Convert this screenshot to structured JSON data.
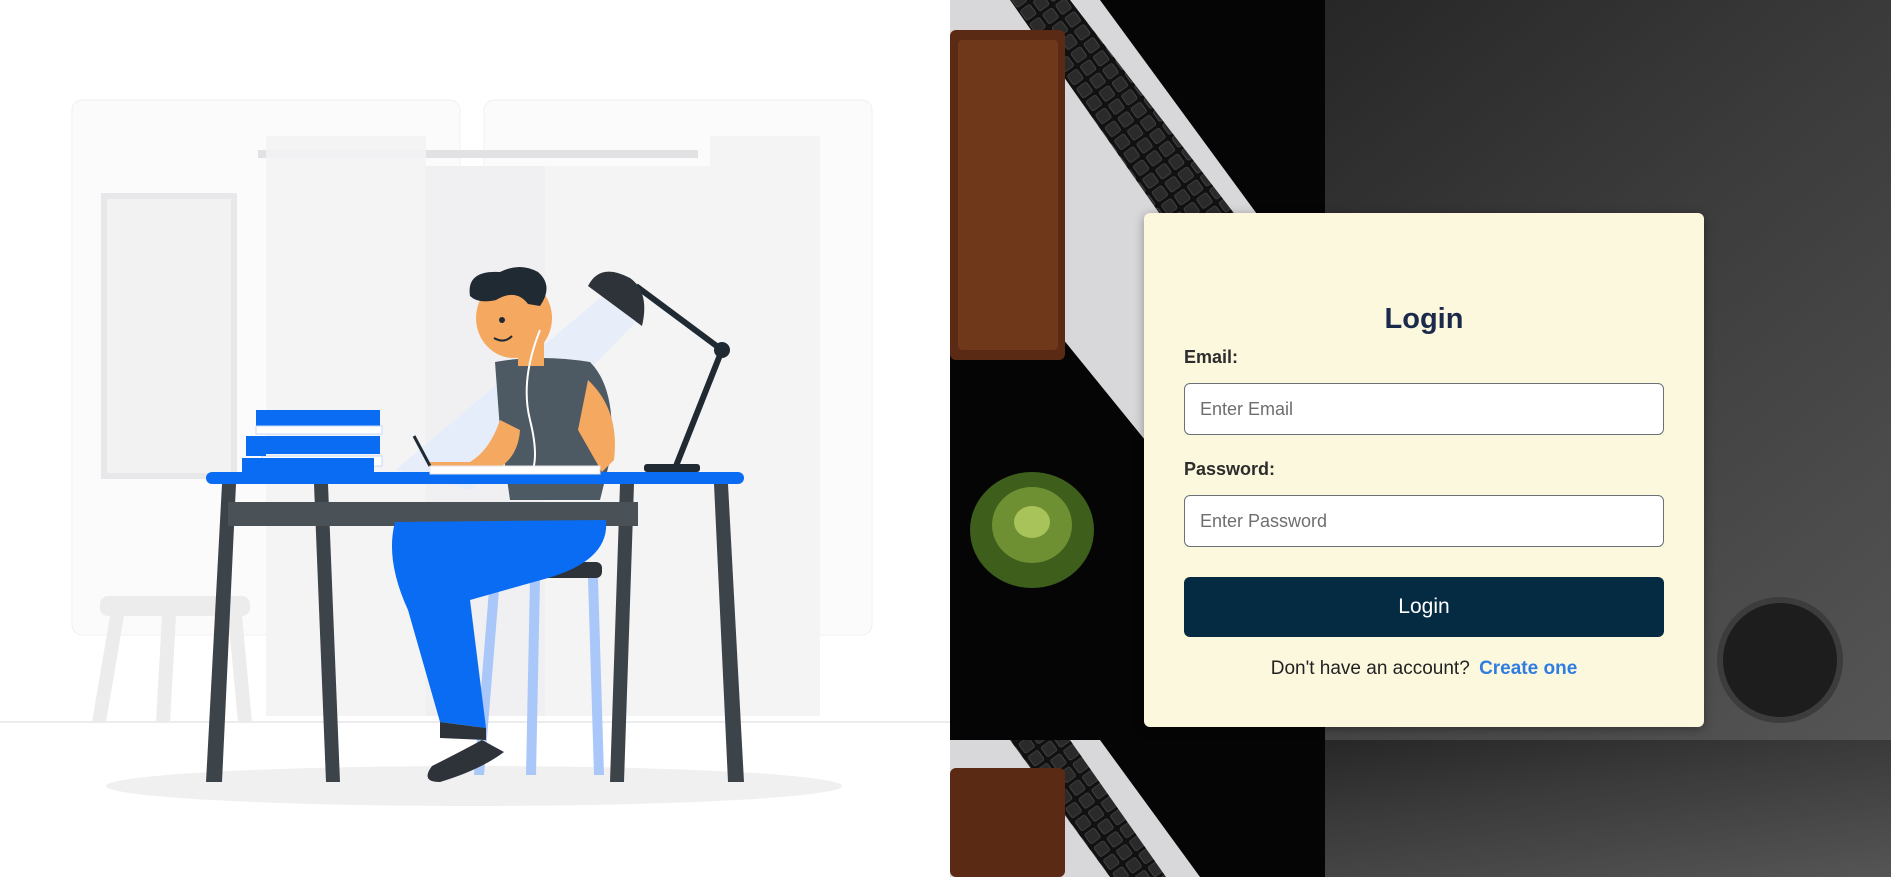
{
  "login": {
    "title": "Login",
    "email_label": "Email:",
    "email_placeholder": "Enter Email",
    "email_value": "",
    "password_label": "Password:",
    "password_placeholder": "Enter Password",
    "password_value": "",
    "submit_label": "Login",
    "signup_prompt": "Don't have an account?",
    "signup_link": "Create one"
  },
  "colors": {
    "card_background": "#fcf8de",
    "button_background": "#052b42",
    "link": "#2f7de0",
    "title": "#1b2a4a",
    "illustration_blue": "#0a6cf2"
  },
  "icons": {
    "illustration": "person-studying-at-desk-illustration",
    "background": "laptop-desk-photo"
  }
}
